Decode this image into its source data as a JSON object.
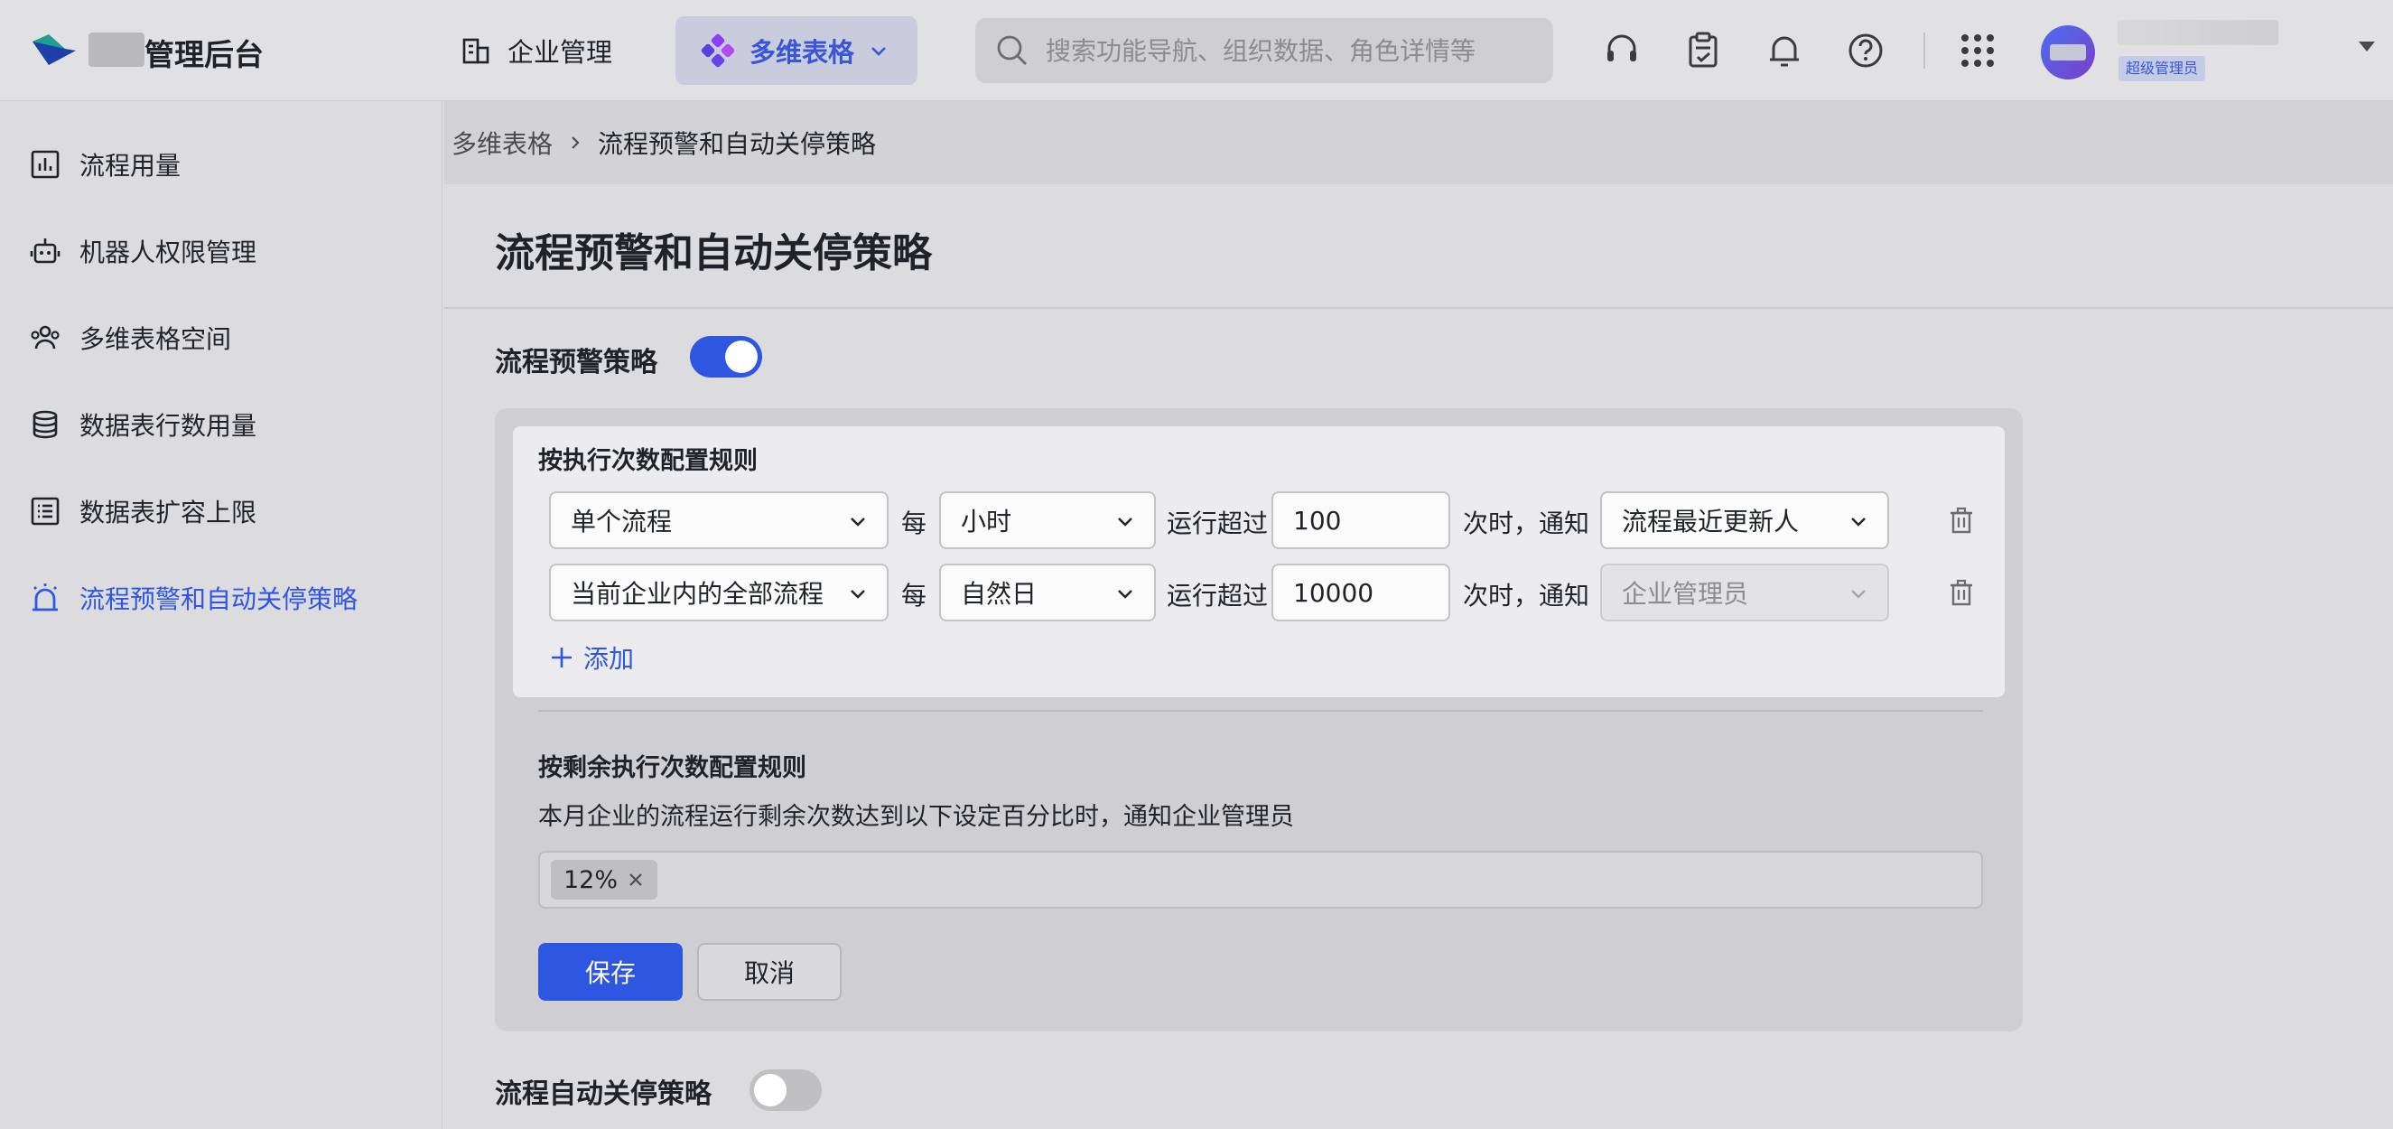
{
  "header": {
    "app_title": "管理后台",
    "nav_company": "企业管理",
    "nav_tables": "多维表格",
    "search_placeholder": "搜索功能导航、组织数据、角色详情等",
    "user_role": "超级管理员",
    "icons": [
      "headset-icon",
      "clipboard-check-icon",
      "bell-icon",
      "help-icon",
      "app-grid-icon"
    ]
  },
  "sidebar": {
    "items": [
      {
        "label": "流程用量",
        "icon": "bar-chart-icon",
        "active": false
      },
      {
        "label": "机器人权限管理",
        "icon": "robot-icon",
        "active": false
      },
      {
        "label": "多维表格空间",
        "icon": "users-icon",
        "active": false
      },
      {
        "label": "数据表行数用量",
        "icon": "database-icon",
        "active": false
      },
      {
        "label": "数据表扩容上限",
        "icon": "list-icon",
        "active": false
      },
      {
        "label": "流程预警和自动关停策略",
        "icon": "alarm-icon",
        "active": true
      }
    ]
  },
  "breadcrumb": {
    "parent": "多维表格",
    "current": "流程预警和自动关停策略"
  },
  "page": {
    "title": "流程预警和自动关停策略",
    "warning_section": {
      "label": "流程预警策略",
      "enabled": true,
      "rule_title": "按执行次数配置规则",
      "rules": [
        {
          "scope": "单个流程",
          "per": "每",
          "period": "小时",
          "run_exceed": "运行超过",
          "count": "100",
          "notify_text": "次时，通知",
          "notify": "流程最近更新人",
          "notify_disabled": false
        },
        {
          "scope": "当前企业内的全部流程",
          "per": "每",
          "period": "自然日",
          "run_exceed": "运行超过",
          "count": "10000",
          "notify_text": "次时，通知",
          "notify": "企业管理员",
          "notify_disabled": true
        }
      ],
      "add_label": "添加",
      "remaining_title": "按剩余执行次数配置规则",
      "remaining_desc": "本月企业的流程运行剩余次数达到以下设定百分比时，通知企业管理员",
      "tags": [
        "12%"
      ],
      "save_label": "保存",
      "cancel_label": "取消"
    },
    "shutdown_section": {
      "label": "流程自动关停策略",
      "enabled": false
    }
  },
  "colors": {
    "accent": "#2f56e0",
    "tab_active_bg": "#c9ccdc"
  }
}
